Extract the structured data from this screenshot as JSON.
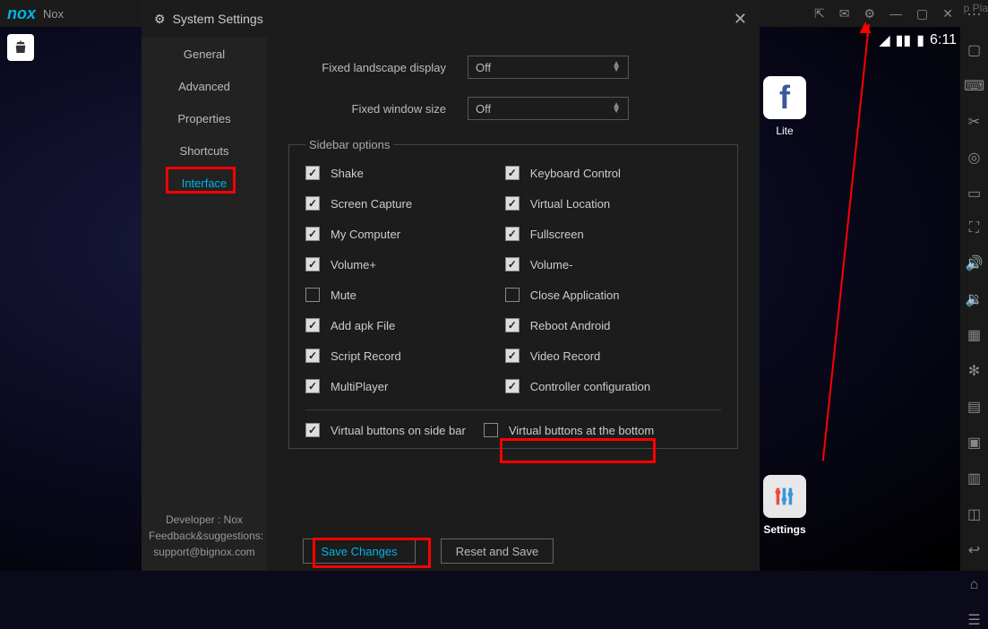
{
  "app": {
    "logo": "nox",
    "name": "Nox"
  },
  "titlebar_partial": "p Pla",
  "statusbar": {
    "time": "6:11"
  },
  "desktop": {
    "lite_label": "Lite",
    "settings_label": "Settings"
  },
  "dialog": {
    "title": "System Settings",
    "nav": [
      "General",
      "Advanced",
      "Properties",
      "Shortcuts",
      "Interface"
    ],
    "active_nav": 4,
    "dev_line1": "Developer : Nox",
    "dev_line2": "Feedback&suggestions:",
    "dev_line3": "support@bignox.com",
    "rows": {
      "landscape_label": "Fixed landscape display",
      "landscape_value": "Off",
      "window_label": "Fixed window size",
      "window_value": "Off"
    },
    "fieldset_legend": "Sidebar options",
    "checkboxes": [
      {
        "label": "Shake",
        "checked": true
      },
      {
        "label": "Keyboard Control",
        "checked": true
      },
      {
        "label": "Screen Capture",
        "checked": true
      },
      {
        "label": "Virtual Location",
        "checked": true
      },
      {
        "label": "My Computer",
        "checked": true
      },
      {
        "label": "Fullscreen",
        "checked": true
      },
      {
        "label": "Volume+",
        "checked": true
      },
      {
        "label": "Volume-",
        "checked": true
      },
      {
        "label": "Mute",
        "checked": false
      },
      {
        "label": "Close Application",
        "checked": false
      },
      {
        "label": "Add apk File",
        "checked": true
      },
      {
        "label": "Reboot Android",
        "checked": true
      },
      {
        "label": "Script Record",
        "checked": true
      },
      {
        "label": "Video Record",
        "checked": true
      },
      {
        "label": "MultiPlayer",
        "checked": true
      },
      {
        "label": "Controller configuration",
        "checked": true
      }
    ],
    "footer_checkboxes": [
      {
        "label": "Virtual buttons on side bar",
        "checked": true
      },
      {
        "label": "Virtual buttons at the bottom",
        "checked": false
      }
    ],
    "save_button": "Save Changes",
    "reset_button": "Reset and Save"
  }
}
